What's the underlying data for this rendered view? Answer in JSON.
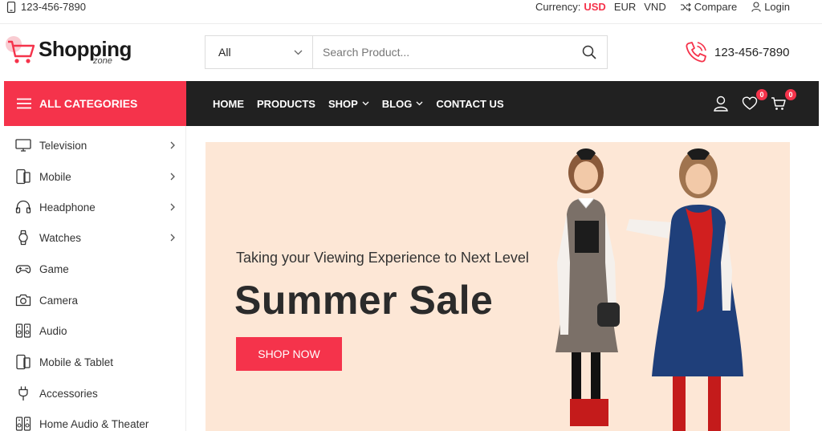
{
  "topbar": {
    "phone": "123-456-7890",
    "currency_label": "Currency:",
    "currencies": [
      "USD",
      "EUR",
      "VND"
    ],
    "compare": "Compare",
    "login": "Login"
  },
  "header": {
    "logo_text": "Shopping",
    "logo_sub": "zone",
    "search": {
      "category": "All",
      "placeholder": "Search Product..."
    },
    "phone": "123-456-7890"
  },
  "nav": {
    "all_categories": "ALL CATEGORIES",
    "items": [
      "HOME",
      "PRODUCTS",
      "SHOP",
      "BLOG",
      "CONTACT US"
    ],
    "wishlist_count": "0",
    "cart_count": "0"
  },
  "sidebar": {
    "items": [
      {
        "label": "Television",
        "icon": "tv-icon",
        "has_sub": true
      },
      {
        "label": "Mobile",
        "icon": "mobile-icon",
        "has_sub": true
      },
      {
        "label": "Headphone",
        "icon": "headphone-icon",
        "has_sub": true
      },
      {
        "label": "Watches",
        "icon": "watch-icon",
        "has_sub": true
      },
      {
        "label": "Game",
        "icon": "gamepad-icon",
        "has_sub": false
      },
      {
        "label": "Camera",
        "icon": "camera-icon",
        "has_sub": false
      },
      {
        "label": "Audio",
        "icon": "speaker-icon",
        "has_sub": false
      },
      {
        "label": "Mobile & Tablet",
        "icon": "tablet-icon",
        "has_sub": false
      },
      {
        "label": "Accessories",
        "icon": "plug-icon",
        "has_sub": false
      },
      {
        "label": "Home Audio & Theater",
        "icon": "speaker-icon",
        "has_sub": false
      }
    ]
  },
  "banner": {
    "subtitle": "Taking your Viewing Experience to Next Level",
    "title": "Summer Sale",
    "cta": "SHOP NOW"
  },
  "colors": {
    "accent": "#f5334b",
    "nav_bg": "#212121",
    "banner_bg": "#fde7d6"
  }
}
